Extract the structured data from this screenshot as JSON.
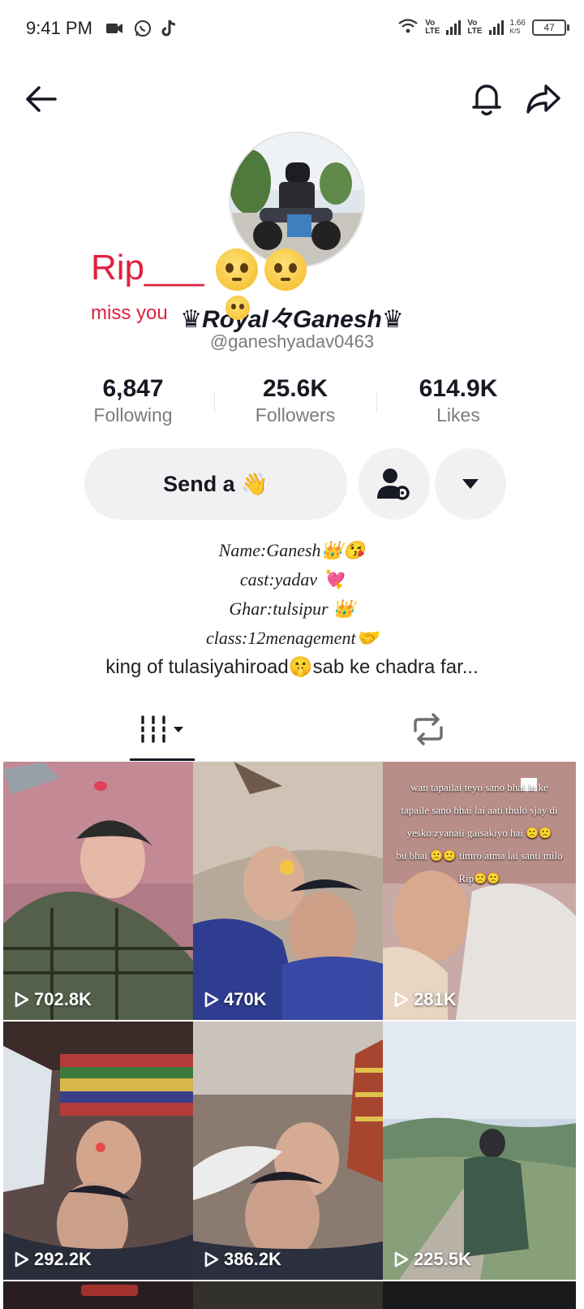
{
  "status_bar": {
    "time": "9:41 PM",
    "net_speed": "1.66",
    "net_unit": "K/S",
    "battery": "47",
    "lte_top": "Vo",
    "lte_bottom": "LTE"
  },
  "header": {
    "back_icon": "arrow-left-icon",
    "bell_icon": "bell-icon",
    "share_icon": "share-icon"
  },
  "profile": {
    "sticker_rip": "Rip___",
    "sticker_miss": "miss you",
    "display_name": "♛Royal々Ganesh♛",
    "handle": "@ganeshyadav0463",
    "stats": [
      {
        "value": "6,847",
        "label": "Following"
      },
      {
        "value": "25.6K",
        "label": "Followers"
      },
      {
        "value": "614.9K",
        "label": "Likes"
      }
    ],
    "send_button": "Send a 👋",
    "bio": [
      "Name:Ganesh👑😘",
      "cast:yadav 💘",
      "Ghar:tulsipur 👑",
      "class:12menagement🤝",
      "king of tulasiyahiroad🤫sab ke chadra far..."
    ]
  },
  "tabs": {
    "videos_icon": "grid-videos-icon",
    "reposts_icon": "repost-icon"
  },
  "videos": [
    {
      "views": "702.8K",
      "text": ""
    },
    {
      "views": "470K",
      "text": ""
    },
    {
      "views": "281K",
      "text": [
        "wan tapailai teyo sano bhai le ke",
        "tapaile sano bhai lai aati thulo sjay di",
        "yesko zyanaii gaisakiyo hai 🙁🙁",
        "bu bhai 🙁🙁 timro atma lai santi milo",
        "Rip🙁🙁"
      ]
    },
    {
      "views": "292.2K",
      "text": ""
    },
    {
      "views": "386.2K",
      "text": ""
    },
    {
      "views": "225.5K",
      "text": ""
    }
  ],
  "colors": {
    "accent_red": "#e0203f",
    "text_primary": "#161823",
    "text_secondary": "#7a7b80",
    "button_bg": "#f1f1f2"
  }
}
